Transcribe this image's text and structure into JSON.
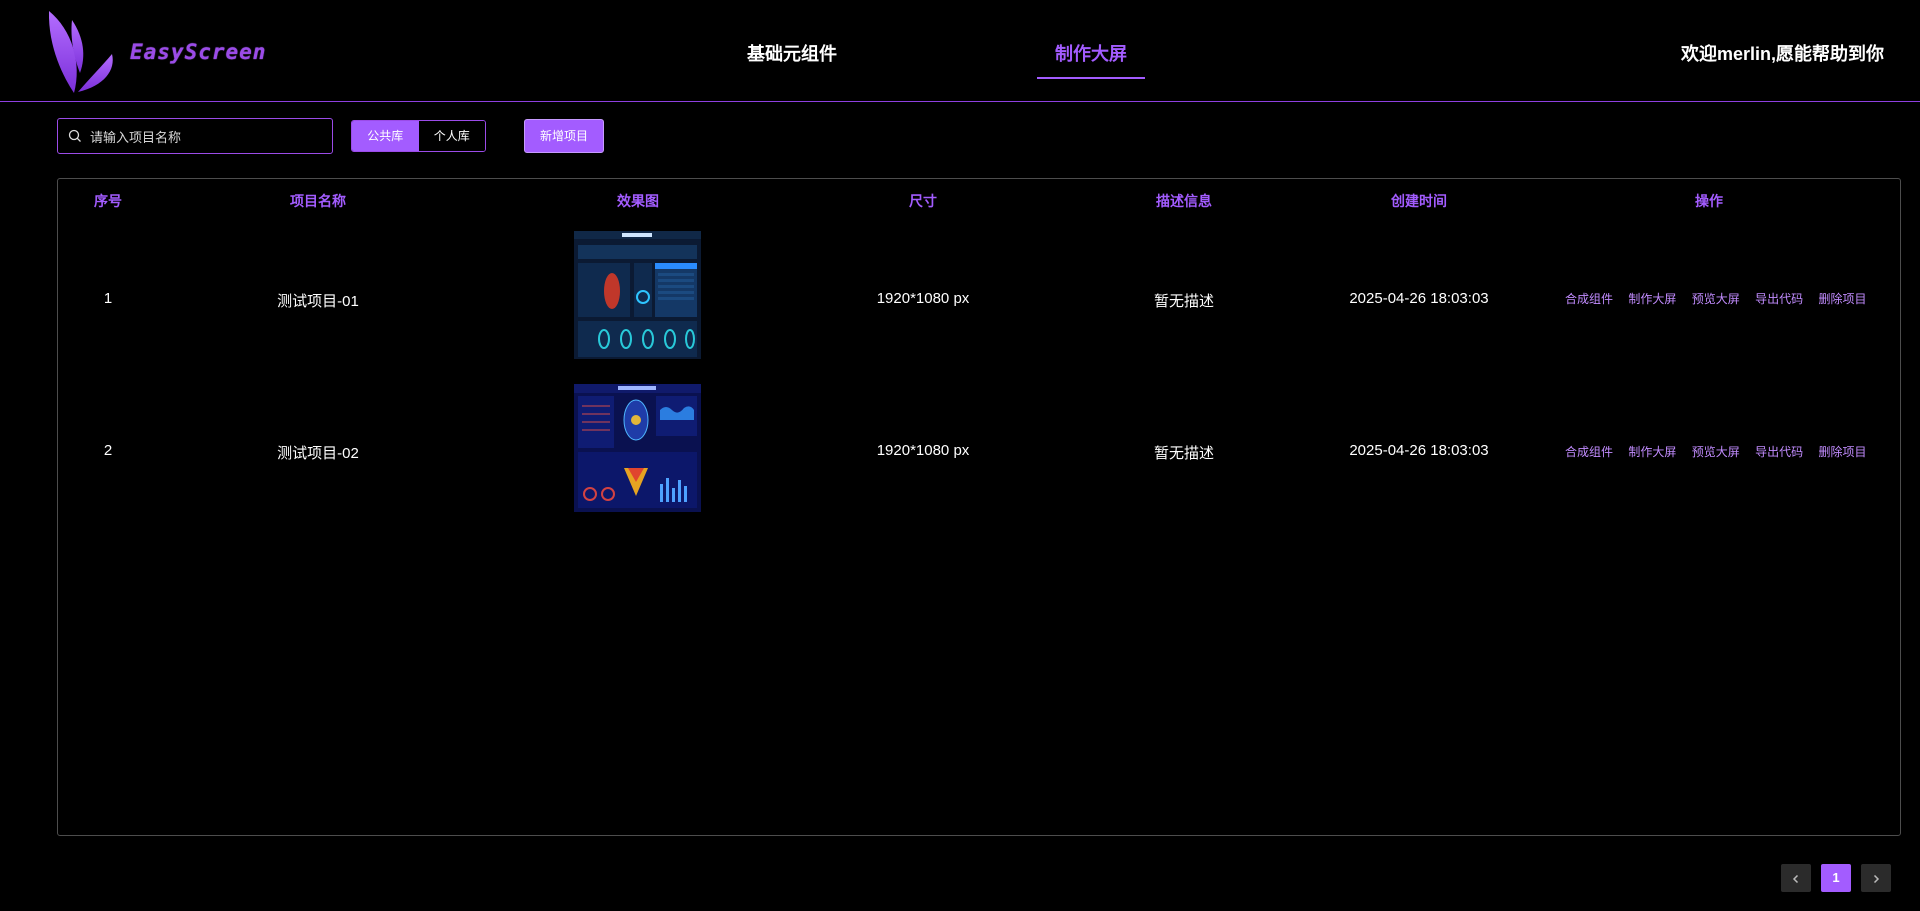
{
  "header": {
    "logo_text": "EasyScreen",
    "nav": [
      {
        "label": "基础元组件",
        "active": false
      },
      {
        "label": "制作大屏",
        "active": true
      }
    ],
    "welcome": "欢迎merlin,愿能帮助到你"
  },
  "toolbar": {
    "search_placeholder": "请输入项目名称",
    "search_value": "",
    "library_tabs": [
      {
        "label": "公共库",
        "active": true
      },
      {
        "label": "个人库",
        "active": false
      }
    ],
    "new_project_label": "新增项目"
  },
  "table": {
    "columns": [
      "序号",
      "项目名称",
      "效果图",
      "尺寸",
      "描述信息",
      "创建时间",
      "操作"
    ],
    "rows": [
      {
        "index": "1",
        "name": "测试项目-01",
        "thumbnail": "dashboard-preview-dark-blue-grid",
        "size": "1920*1080 px",
        "description": "暂无描述",
        "created": "2025-04-26 18:03:03",
        "actions": [
          "合成组件",
          "制作大屏",
          "预览大屏",
          "导出代码",
          "删除项目"
        ]
      },
      {
        "index": "2",
        "name": "测试项目-02",
        "thumbnail": "dashboard-preview-blue-world-map",
        "size": "1920*1080 px",
        "description": "暂无描述",
        "created": "2025-04-26 18:03:03",
        "actions": [
          "合成组件",
          "制作大屏",
          "预览大屏",
          "导出代码",
          "删除项目"
        ]
      }
    ]
  },
  "pagination": {
    "prev_icon": "chevron-left-icon",
    "current_page": "1",
    "next_icon": "chevron-right-icon"
  },
  "colors": {
    "accent": "#a35cff",
    "border_accent": "#9b4be8",
    "header_line": "#8e3fe0",
    "action_link": "#c28cff",
    "background": "#000000"
  }
}
